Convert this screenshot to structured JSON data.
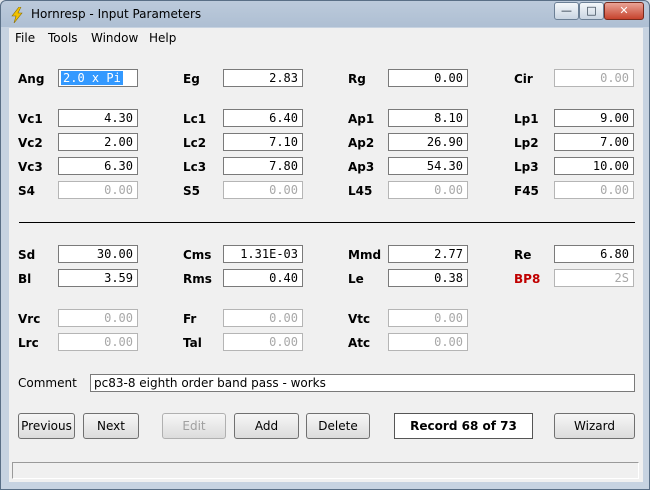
{
  "window": {
    "title": "Hornresp - Input Parameters",
    "minimize": "—",
    "maximize": "□",
    "close": "✕"
  },
  "menu": [
    "File",
    "Tools",
    "Window",
    "Help"
  ],
  "labels": {
    "ang": "Ang",
    "eg": "Eg",
    "rg": "Rg",
    "cir": "Cir",
    "vc1": "Vc1",
    "lc1": "Lc1",
    "ap1": "Ap1",
    "lp1": "Lp1",
    "vc2": "Vc2",
    "lc2": "Lc2",
    "ap2": "Ap2",
    "lp2": "Lp2",
    "vc3": "Vc3",
    "lc3": "Lc3",
    "ap3": "Ap3",
    "lp3": "Lp3",
    "s4": "S4",
    "s5": "S5",
    "l45": "L45",
    "f45": "F45",
    "sd": "Sd",
    "cms": "Cms",
    "mmd": "Mmd",
    "re": "Re",
    "bl": "Bl",
    "rms": "Rms",
    "le": "Le",
    "bp8": "BP8",
    "vrc": "Vrc",
    "fr": "Fr",
    "vtc": "Vtc",
    "lrc": "Lrc",
    "tal": "Tal",
    "atc": "Atc",
    "comment": "Comment"
  },
  "values": {
    "ang": "2.0 x Pi",
    "eg": "2.83",
    "rg": "0.00",
    "cir": "0.00",
    "vc1": "4.30",
    "lc1": "6.40",
    "ap1": "8.10",
    "lp1": "9.00",
    "vc2": "2.00",
    "lc2": "7.10",
    "ap2": "26.90",
    "lp2": "7.00",
    "vc3": "6.30",
    "lc3": "7.80",
    "ap3": "54.30",
    "lp3": "10.00",
    "s4": "0.00",
    "s5": "0.00",
    "l45": "0.00",
    "f45": "0.00",
    "sd": "30.00",
    "cms": "1.31E-03",
    "mmd": "2.77",
    "re": "6.80",
    "bl": "3.59",
    "rms": "0.40",
    "le": "0.38",
    "bp8": "2S",
    "vrc": "0.00",
    "fr": "0.00",
    "vtc": "0.00",
    "lrc": "0.00",
    "tal": "0.00",
    "atc": "0.00",
    "comment": "pc83-8 eighth order band pass - works"
  },
  "buttons": {
    "previous": "Previous",
    "next": "Next",
    "edit": "Edit",
    "add": "Add",
    "delete": "Delete",
    "wizard": "Wizard"
  },
  "record": "Record 68 of 73",
  "colors": {
    "selection": "#3399ff",
    "bp8_label": "#c00000",
    "close_button": "#c7432d"
  },
  "icons": {
    "app": "lightning-bolt-icon"
  }
}
